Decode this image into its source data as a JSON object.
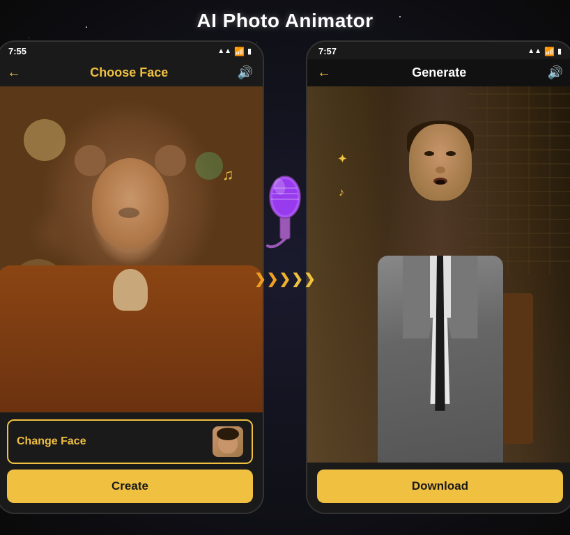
{
  "page": {
    "title": "AI Photo Animator",
    "background": "#0a0a0a"
  },
  "left_phone": {
    "status_time": "7:55",
    "header_title": "Choose Face",
    "header_title_color": "yellow",
    "change_face_label": "Change Face",
    "create_button_label": "Create"
  },
  "right_phone": {
    "status_time": "7:57",
    "header_title": "Generate",
    "header_title_color": "white",
    "download_button_label": "Download"
  },
  "icons": {
    "back_arrow": "←",
    "sound": "🔊",
    "signal": "▲▲",
    "wifi": "▼",
    "battery": "🔋",
    "music_note": "♪",
    "music_notes": "♫",
    "sparkle": "✦",
    "arrow_right": "❯"
  }
}
